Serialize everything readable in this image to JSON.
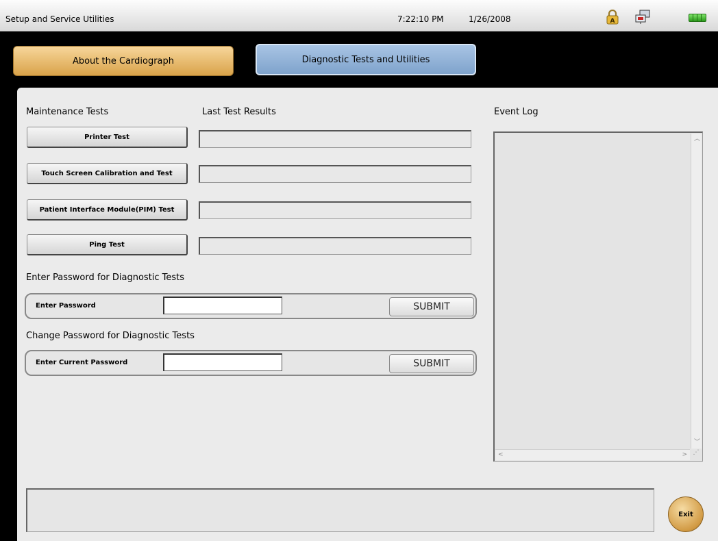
{
  "titlebar": {
    "title": "Setup and Service Utilities",
    "time": "7:22:10 PM",
    "date": "1/26/2008",
    "icons": [
      "lock-icon",
      "network-icon",
      "battery-icon"
    ]
  },
  "tabs": [
    {
      "label": "About the Cardiograph",
      "active": false
    },
    {
      "label": "Diagnostic Tests and Utilities",
      "active": true
    }
  ],
  "maintenance": {
    "heading": "Maintenance Tests",
    "results_heading": "Last Test Results",
    "tests": [
      {
        "label": "Printer Test",
        "result": ""
      },
      {
        "label": "Touch Screen Calibration and Test",
        "result": ""
      },
      {
        "label": "Patient Interface Module(PIM) Test",
        "result": ""
      },
      {
        "label": "Ping Test",
        "result": ""
      }
    ]
  },
  "enter_password": {
    "heading": "Enter Password for Diagnostic Tests",
    "field_label": "Enter Password",
    "value": "",
    "submit_label": "SUBMIT"
  },
  "change_password": {
    "heading": "Change Password for Diagnostic Tests",
    "field_label": "Enter Current Password",
    "value": "",
    "submit_label": "SUBMIT"
  },
  "event_log": {
    "heading": "Event Log",
    "content": ""
  },
  "status": {
    "message": ""
  },
  "exit_label": "Exit",
  "colors": {
    "tab_about": "#e3b25f",
    "tab_active": "#8fb1d8",
    "panel": "#ebebeb",
    "exit": "#d6a04a"
  }
}
